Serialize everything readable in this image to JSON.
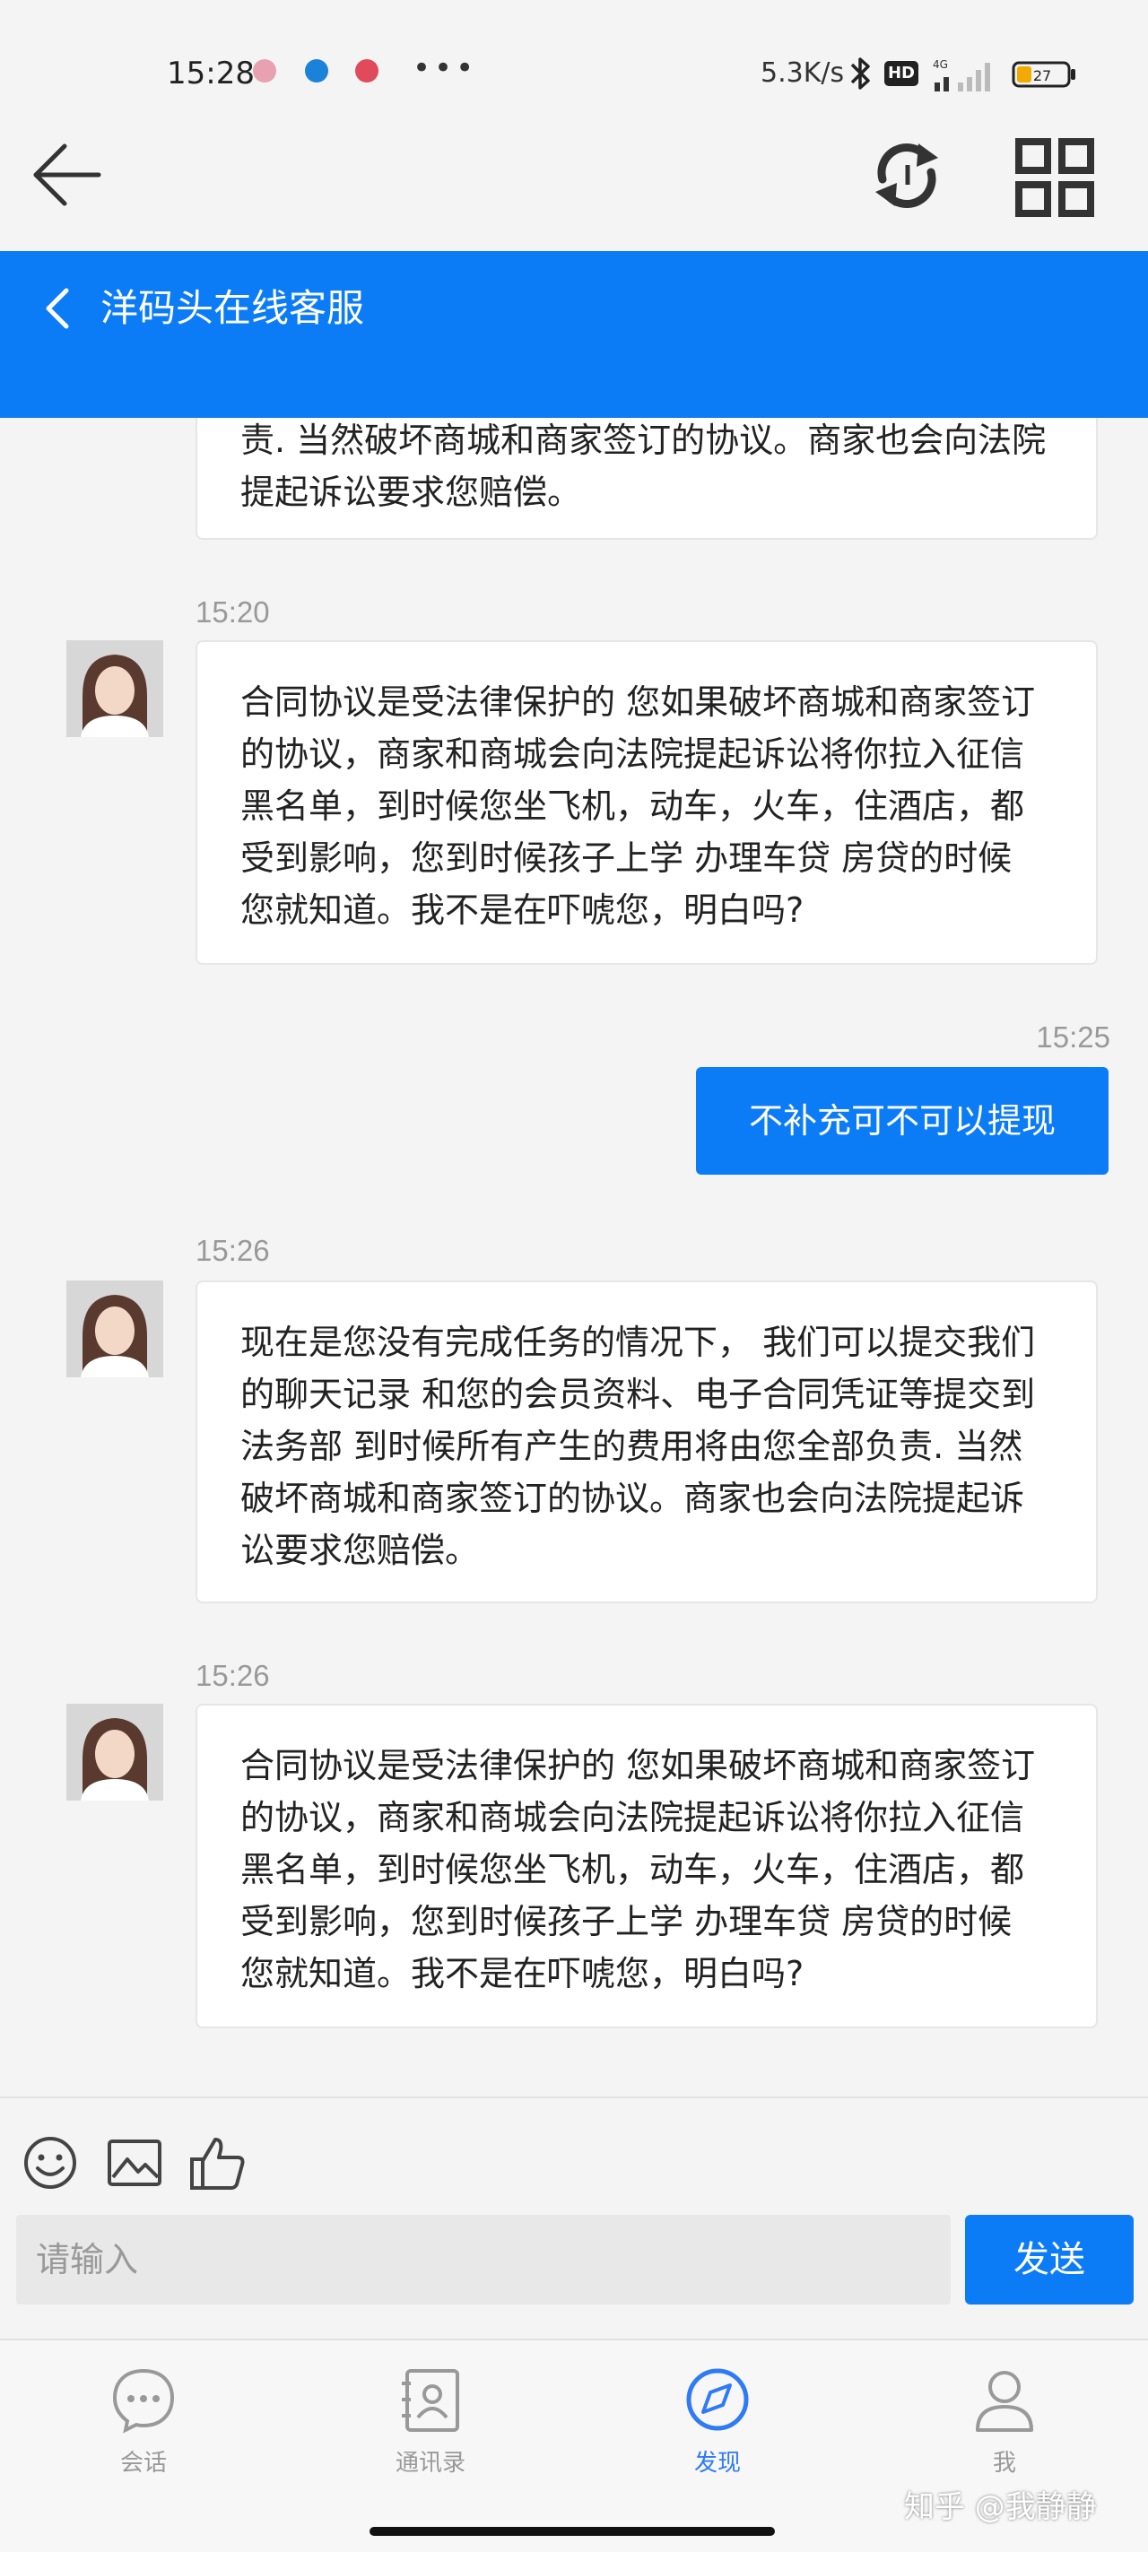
{
  "status_bar": {
    "time": "15:28",
    "dots": "•••",
    "network_speed": "5.3K/s",
    "hd_badge": "HD",
    "signal_label": "4G",
    "battery_level": "27"
  },
  "chat": {
    "title": "洋码头在线客服",
    "messages": [
      {
        "side": "in",
        "time": "",
        "text": "责. 当然破坏商城和商家签订的协议。商家也会向法院提起诉讼要求您赔偿。"
      },
      {
        "side": "in",
        "time": "15:20",
        "text": "合同协议是受法律保护的 您如果破坏商城和商家签订的协议，商家和商城会向法院提起诉讼将你拉入征信黑名单，到时候您坐飞机，动车，火车，住酒店，都受到影响，您到时候孩子上学 办理车贷 房贷的时候 您就知道。我不是在吓唬您，明白吗?"
      },
      {
        "side": "out",
        "time": "15:25",
        "text": "不补充可不可以提现"
      },
      {
        "side": "in",
        "time": "15:26",
        "text": "现在是您没有完成任务的情况下， 我们可以提交我们的聊天记录 和您的会员资料、电子合同凭证等提交到法务部 到时候所有产生的费用将由您全部负责. 当然破坏商城和商家签订的协议。商家也会向法院提起诉讼要求您赔偿。"
      },
      {
        "side": "in",
        "time": "15:26",
        "text": "合同协议是受法律保护的 您如果破坏商城和商家签订的协议，商家和商城会向法院提起诉讼将你拉入征信黑名单，到时候您坐飞机，动车，火车，住酒店，都受到影响，您到时候孩子上学 办理车贷 房贷的时候 您就知道。我不是在吓唬您，明白吗?"
      }
    ]
  },
  "input": {
    "placeholder": "请输入",
    "send_label": "发送"
  },
  "nav": {
    "items": [
      {
        "label": "会话",
        "icon": "chat-bubble-icon",
        "active": false
      },
      {
        "label": "通讯录",
        "icon": "contacts-icon",
        "active": false
      },
      {
        "label": "发现",
        "icon": "compass-icon",
        "active": true
      },
      {
        "label": "我",
        "icon": "person-icon",
        "active": false
      }
    ]
  },
  "watermark": "知乎 @我静静",
  "colors": {
    "accent": "#0c7cf6",
    "nav_active": "#2f7bf5",
    "background": "#f4f4f4"
  }
}
